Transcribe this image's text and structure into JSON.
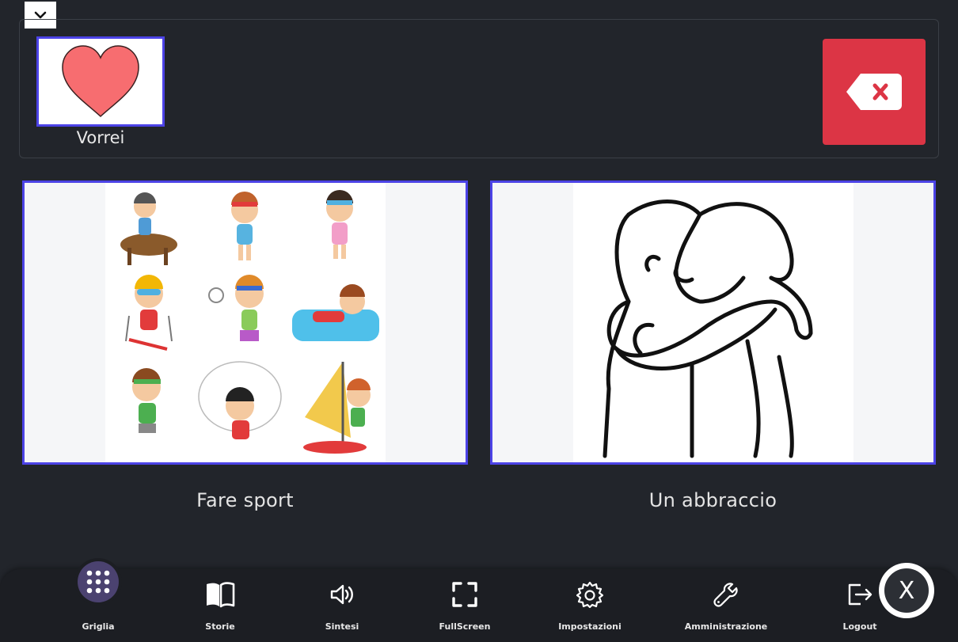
{
  "sentence": {
    "items": [
      {
        "label": "Vorrei",
        "icon": "heart-icon"
      }
    ]
  },
  "grid": {
    "cards": [
      {
        "label": "Fare sport",
        "image": "sports-kids-image"
      },
      {
        "label": "Un abbraccio",
        "image": "hug-image"
      }
    ]
  },
  "nav": {
    "items": [
      {
        "label": "Griglia",
        "icon": "grid-dots-icon",
        "active": true
      },
      {
        "label": "Storie",
        "icon": "book-icon"
      },
      {
        "label": "Sintesi",
        "icon": "speaker-icon"
      },
      {
        "label": "FullScreen",
        "icon": "fullscreen-icon"
      },
      {
        "label": "Impostazioni",
        "icon": "gear-icon"
      },
      {
        "label": "Amministrazione",
        "icon": "wrench-icon"
      },
      {
        "label": "Logout",
        "icon": "logout-icon"
      }
    ]
  },
  "close": {
    "label": "X"
  },
  "colors": {
    "accent": "#4c43e6",
    "danger": "#dc3545",
    "background": "#22252b",
    "nav_active": "#4b4270"
  }
}
